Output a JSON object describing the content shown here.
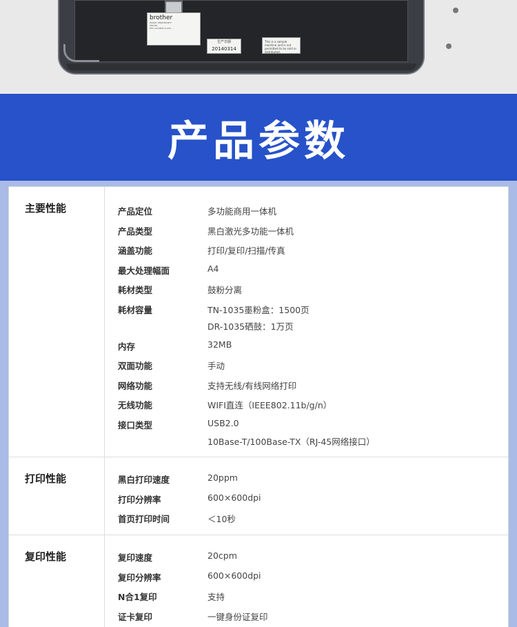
{
  "photo": {
    "label_brand": "brother",
    "label_fine_lines": [
      "MODEL PRINTER/MFC",
      "SER.NO.",
      "MFC-1919NW  CLASS  ..."
    ],
    "date_label": "生产日期",
    "date_value": "20140314",
    "sample_note_lines": [
      "This is a sample machine and is not",
      "permitted to be sold or distributed."
    ]
  },
  "banner": {
    "title": "产品参数"
  },
  "sections": [
    {
      "title": "主要性能",
      "rows": [
        {
          "key": "产品定位",
          "values": [
            "多功能商用一体机"
          ]
        },
        {
          "key": "产品类型",
          "values": [
            "黑白激光多功能一体机"
          ]
        },
        {
          "key": "涵盖功能",
          "values": [
            "打印/复印/扫描/传真"
          ]
        },
        {
          "key": "最大处理幅面",
          "values": [
            "A4"
          ]
        },
        {
          "key": "耗材类型",
          "values": [
            "鼓粉分离"
          ]
        },
        {
          "key": "耗材容量",
          "values": [
            "TN-1035墨粉盒：1500页",
            "DR-1035硒鼓：1万页"
          ]
        },
        {
          "key": "内存",
          "values": [
            "32MB"
          ]
        },
        {
          "key": "双面功能",
          "values": [
            "手动"
          ]
        },
        {
          "key": "网络功能",
          "values": [
            "支持无线/有线网络打印"
          ]
        },
        {
          "key": "无线功能",
          "values": [
            "WIFI直连（IEEE802.11b/g/n）"
          ]
        },
        {
          "key": "接口类型",
          "values": [
            "USB2.0",
            "10Base-T/100Base-TX（RJ-45网络接口）"
          ]
        }
      ]
    },
    {
      "title": "打印性能",
      "rows": [
        {
          "key": "黑白打印速度",
          "values": [
            "20ppm"
          ]
        },
        {
          "key": "打印分辨率",
          "values": [
            "600×600dpi"
          ]
        },
        {
          "key": "首页打印时间",
          "values": [
            "＜10秒"
          ]
        }
      ]
    },
    {
      "title": "复印性能",
      "rows": [
        {
          "key": "复印速度",
          "values": [
            "20cpm"
          ]
        },
        {
          "key": "复印分辨率",
          "values": [
            "600×600dpi"
          ]
        },
        {
          "key": "N合1复印",
          "values": [
            "支持"
          ]
        },
        {
          "key": "证卡复印",
          "values": [
            "一键身份证复印"
          ]
        }
      ]
    }
  ]
}
